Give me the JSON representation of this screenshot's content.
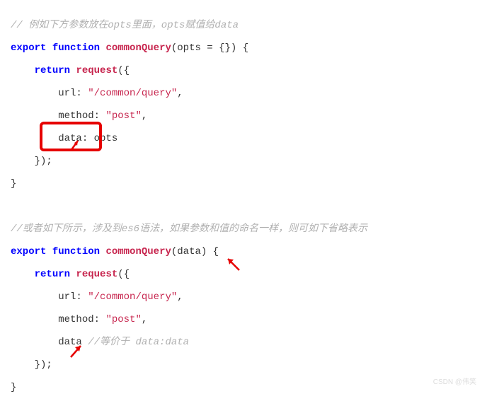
{
  "comment1": "// 例如下方参数放在opts里面，opts赋值给data",
  "block1": {
    "l1_kw1": "export",
    "l1_kw2": "function",
    "l1_fn": "commonQuery",
    "l1_rest": "(opts = {}) {",
    "l2_kw": "return",
    "l2_fn": "request",
    "l2_rest": "({",
    "l3_lbl": "url:",
    "l3_str": "\"/common/query\"",
    "l3_rest": ",",
    "l4_lbl": "method:",
    "l4_str": "\"post\"",
    "l4_rest": ",",
    "l5": "data: opts",
    "l6": "});",
    "l7": "}"
  },
  "comment2": "//或者如下所示，涉及到es6语法，如果参数和值的命名一样，则可如下省略表示",
  "block2": {
    "l1_kw1": "export",
    "l1_kw2": "function",
    "l1_fn": "commonQuery",
    "l1_rest": "(data) {",
    "l2_kw": "return",
    "l2_fn": "request",
    "l2_rest": "({",
    "l3_lbl": "url:",
    "l3_str": "\"/common/query\"",
    "l3_rest": ",",
    "l4_lbl": "method:",
    "l4_str": "\"post\"",
    "l4_rest": ",",
    "l5_code": "data",
    "l5_cm": "//等价于 data:data",
    "l6": "});",
    "l7": "}"
  },
  "watermark": "CSDN @伟笑"
}
